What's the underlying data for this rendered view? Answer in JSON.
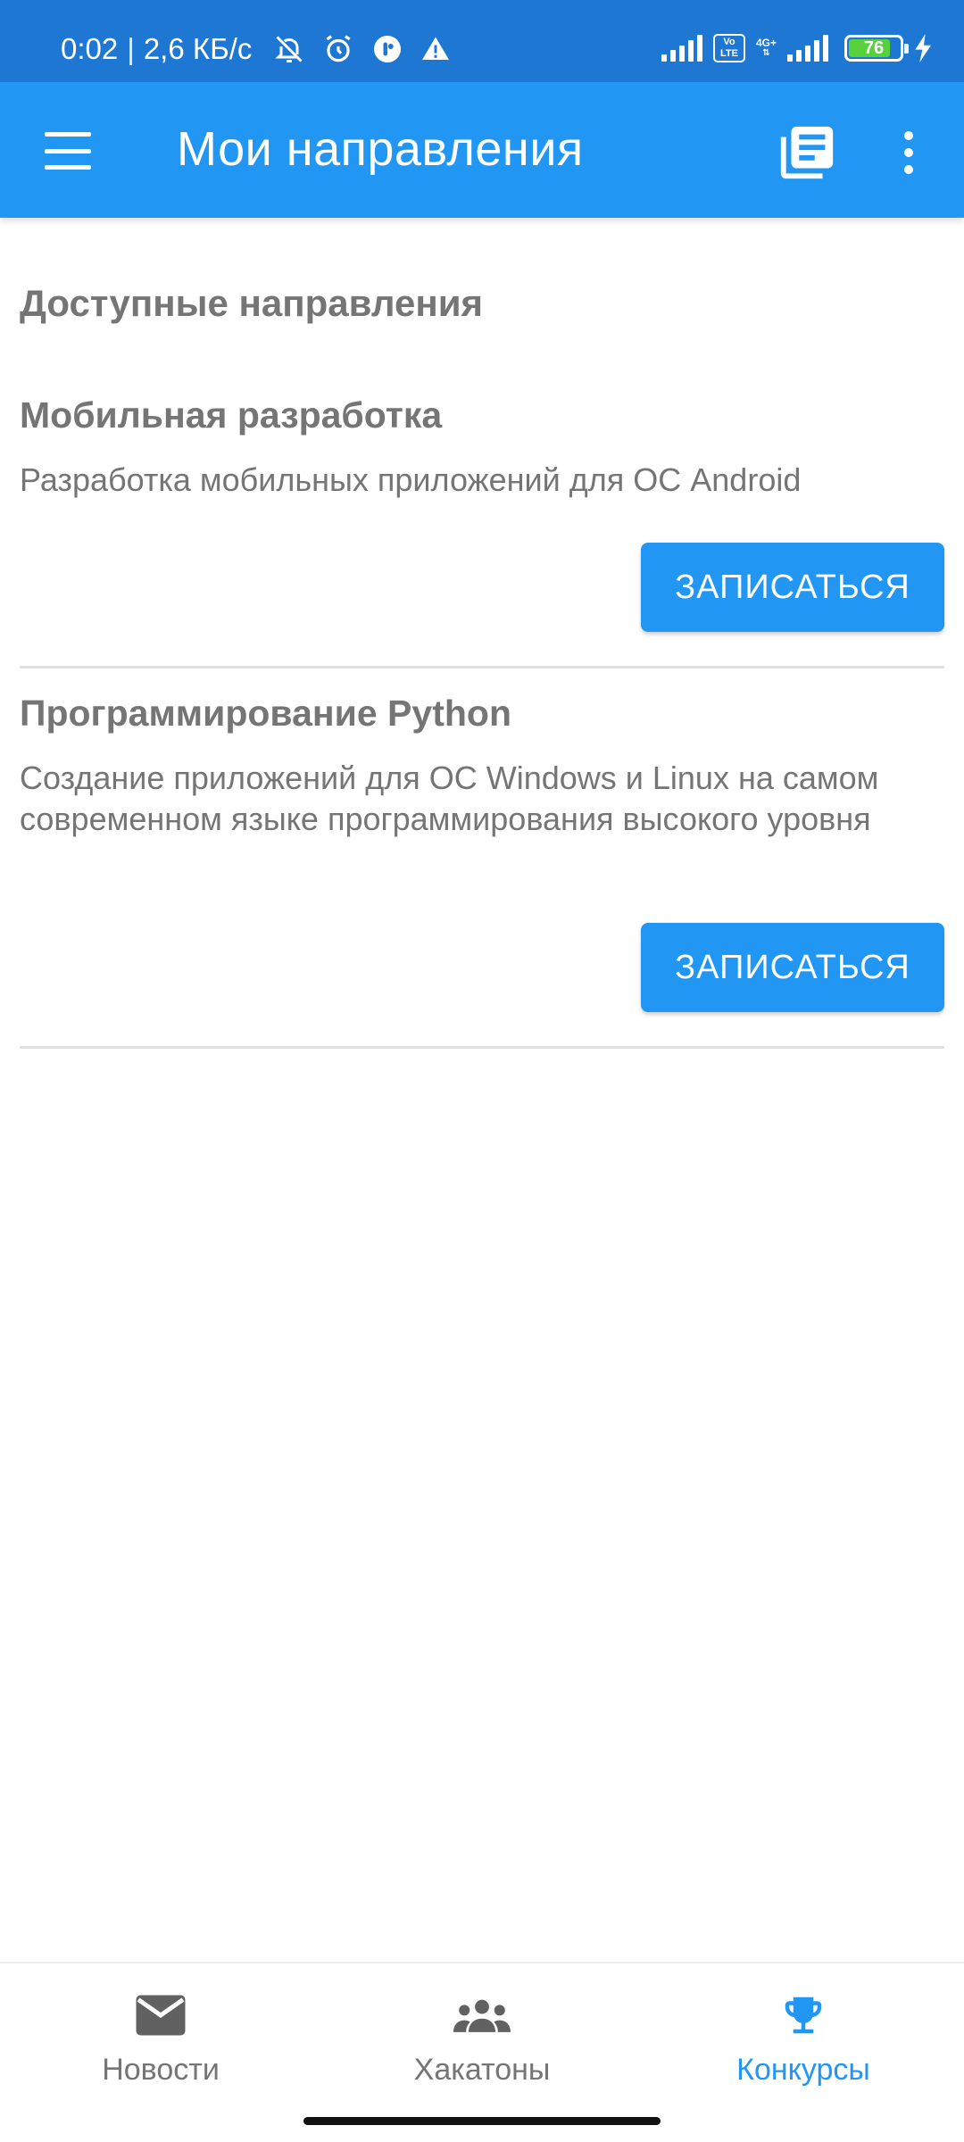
{
  "status_bar": {
    "time": "0:02",
    "separator": "|",
    "net_speed": "2,6 КБ/с",
    "icons": [
      "bell-off-icon",
      "alarm-icon",
      "messenger-icon",
      "warning-icon"
    ],
    "network_label": "4G+",
    "volte_label": "Vo LTE",
    "battery_level": "76"
  },
  "app_bar": {
    "title": "Мои направления",
    "icons": [
      "menu-icon",
      "library-books-icon",
      "more-vert-icon"
    ]
  },
  "content": {
    "section_heading": "Доступные направления",
    "cards": [
      {
        "title": "Мобильная разработка",
        "description": "Разработка мобильных приложений для ОС Android",
        "button_label": "ЗАПИСАТЬСЯ"
      },
      {
        "title": "Программирование Python",
        "description": "Создание приложений для ОС Windows и Linux на самом современном языке программирования высокого уровня",
        "button_label": "ЗАПИСАТЬСЯ"
      }
    ]
  },
  "bottom_nav": {
    "items": [
      {
        "label": "Новости",
        "icon": "mail-icon",
        "active": false
      },
      {
        "label": "Хакатоны",
        "icon": "group-icon",
        "active": false
      },
      {
        "label": "Конкурсы",
        "icon": "trophy-icon",
        "active": true
      }
    ]
  },
  "colors": {
    "status_bar": "#1f77d4",
    "primary": "#2196f3",
    "text_secondary": "#757575",
    "divider": "#e0e0e0"
  }
}
